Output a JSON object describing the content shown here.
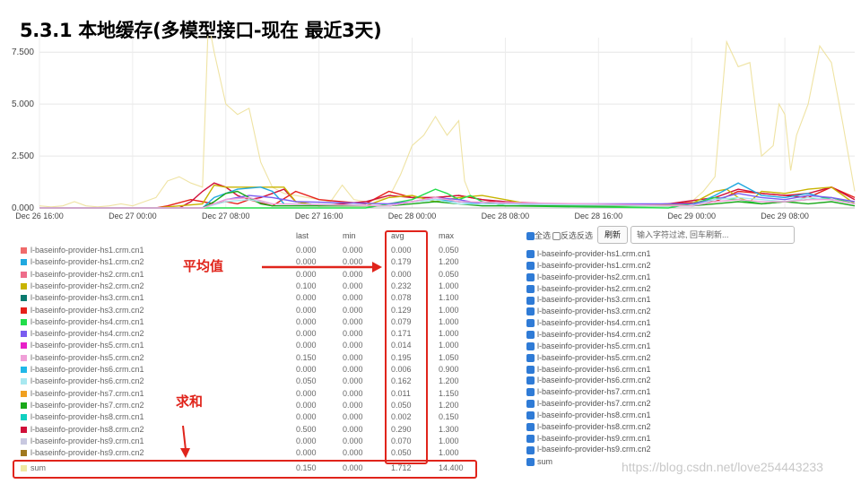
{
  "slide_title": "5.3.1 本地缓存(多模型接口-现在 最近3天)",
  "annotations": {
    "avg_label": "平均值",
    "sum_label": "求和"
  },
  "table": {
    "headers": {
      "last": "last",
      "min": "min",
      "avg": "avg",
      "max": "max"
    },
    "rows": [
      {
        "name": "l-baseinfo-provider-hs1.crm.cn1",
        "color": "#f06b6b",
        "last": "0.000",
        "min": "0.000",
        "avg": "0.000",
        "max": "0.050"
      },
      {
        "name": "l-baseinfo-provider-hs1.crm.cn2",
        "color": "#20a9e0",
        "last": "0.000",
        "min": "0.000",
        "avg": "0.179",
        "max": "1.200"
      },
      {
        "name": "l-baseinfo-provider-hs2.crm.cn1",
        "color": "#ee6c8a",
        "last": "0.000",
        "min": "0.000",
        "avg": "0.000",
        "max": "0.050"
      },
      {
        "name": "l-baseinfo-provider-hs2.crm.cn2",
        "color": "#c8b400",
        "last": "0.100",
        "min": "0.000",
        "avg": "0.232",
        "max": "1.000"
      },
      {
        "name": "l-baseinfo-provider-hs3.crm.cn1",
        "color": "#0a7a6e",
        "last": "0.000",
        "min": "0.000",
        "avg": "0.078",
        "max": "1.100"
      },
      {
        "name": "l-baseinfo-provider-hs3.crm.cn2",
        "color": "#e6201a",
        "last": "0.000",
        "min": "0.000",
        "avg": "0.129",
        "max": "1.000"
      },
      {
        "name": "l-baseinfo-provider-hs4.crm.cn1",
        "color": "#22dd4a",
        "last": "0.000",
        "min": "0.000",
        "avg": "0.079",
        "max": "1.000"
      },
      {
        "name": "l-baseinfo-provider-hs4.crm.cn2",
        "color": "#7a5cf0",
        "last": "0.000",
        "min": "0.000",
        "avg": "0.171",
        "max": "1.000"
      },
      {
        "name": "l-baseinfo-provider-hs5.crm.cn1",
        "color": "#e820c8",
        "last": "0.000",
        "min": "0.000",
        "avg": "0.014",
        "max": "1.000"
      },
      {
        "name": "l-baseinfo-provider-hs5.crm.cn2",
        "color": "#f0a0d8",
        "last": "0.150",
        "min": "0.000",
        "avg": "0.195",
        "max": "1.050"
      },
      {
        "name": "l-baseinfo-provider-hs6.crm.cn1",
        "color": "#20b8e8",
        "last": "0.000",
        "min": "0.000",
        "avg": "0.006",
        "max": "0.900"
      },
      {
        "name": "l-baseinfo-provider-hs6.crm.cn2",
        "color": "#a8e8f0",
        "last": "0.050",
        "min": "0.000",
        "avg": "0.162",
        "max": "1.200"
      },
      {
        "name": "l-baseinfo-provider-hs7.crm.cn1",
        "color": "#f0a020",
        "last": "0.000",
        "min": "0.000",
        "avg": "0.011",
        "max": "1.150"
      },
      {
        "name": "l-baseinfo-provider-hs7.crm.cn2",
        "color": "#1aa81a",
        "last": "0.000",
        "min": "0.000",
        "avg": "0.050",
        "max": "1.200"
      },
      {
        "name": "l-baseinfo-provider-hs8.crm.cn1",
        "color": "#10d0c0",
        "last": "0.000",
        "min": "0.000",
        "avg": "0.002",
        "max": "0.150"
      },
      {
        "name": "l-baseinfo-provider-hs8.crm.cn2",
        "color": "#d0103a",
        "last": "0.500",
        "min": "0.000",
        "avg": "0.290",
        "max": "1.300"
      },
      {
        "name": "l-baseinfo-provider-hs9.crm.cn1",
        "color": "#c8c8e0",
        "last": "0.000",
        "min": "0.000",
        "avg": "0.070",
        "max": "1.000"
      },
      {
        "name": "l-baseinfo-provider-hs9.crm.cn2",
        "color": "#a0781e",
        "last": "0.000",
        "min": "0.000",
        "avg": "0.050",
        "max": "1.000"
      },
      {
        "name": "sum",
        "color": "#f0e8a0",
        "last": "0.150",
        "min": "0.000",
        "avg": "1.712",
        "max": "14.400"
      }
    ]
  },
  "filter": {
    "select_all": "全选",
    "invert": "反选",
    "invert_suffix": "反选",
    "refresh_label": "刷新",
    "input_placeholder": "输入字符过滤, 回车刷新..."
  },
  "right_list": [
    "l-baseinfo-provider-hs1.crm.cn1",
    "l-baseinfo-provider-hs1.crm.cn2",
    "l-baseinfo-provider-hs2.crm.cn1",
    "l-baseinfo-provider-hs2.crm.cn2",
    "l-baseinfo-provider-hs3.crm.cn1",
    "l-baseinfo-provider-hs3.crm.cn2",
    "l-baseinfo-provider-hs4.crm.cn1",
    "l-baseinfo-provider-hs4.crm.cn2",
    "l-baseinfo-provider-hs5.crm.cn1",
    "l-baseinfo-provider-hs5.crm.cn2",
    "l-baseinfo-provider-hs6.crm.cn1",
    "l-baseinfo-provider-hs6.crm.cn2",
    "l-baseinfo-provider-hs7.crm.cn1",
    "l-baseinfo-provider-hs7.crm.cn2",
    "l-baseinfo-provider-hs8.crm.cn1",
    "l-baseinfo-provider-hs8.crm.cn2",
    "l-baseinfo-provider-hs9.crm.cn1",
    "l-baseinfo-provider-hs9.crm.cn2",
    "sum"
  ],
  "watermark": "https://blog.csdn.net/love254443233",
  "chart_data": {
    "type": "line",
    "ylim": [
      0,
      8.2
    ],
    "y_ticks": [
      "0.000",
      "2.500",
      "5.000",
      "7.500"
    ],
    "y_tick_values": [
      0,
      2.5,
      5,
      7.5
    ],
    "x_ticks": [
      "Dec 26 16:00",
      "Dec 27 00:00",
      "Dec 27 08:00",
      "Dec 27 16:00",
      "Dec 28 00:00",
      "Dec 28 08:00",
      "Dec 28 16:00",
      "Dec 29 00:00",
      "Dec 29 08:00"
    ],
    "x_tick_hours": [
      16,
      24,
      32,
      40,
      48,
      56,
      64,
      72,
      80
    ],
    "xlim_hours": [
      16,
      86
    ],
    "series": [
      {
        "name": "sum",
        "color": "#efe3a3",
        "x": [
          16,
          17,
          18,
          19,
          20,
          21,
          22,
          23,
          24,
          25,
          26,
          27,
          28,
          29,
          30,
          30.5,
          31,
          32,
          33,
          34,
          35,
          36,
          37,
          38,
          39,
          40,
          41,
          42,
          43,
          44,
          45,
          46,
          47,
          48,
          49,
          50,
          51,
          52,
          52.5,
          53,
          54,
          55,
          56,
          57,
          58,
          59,
          60,
          61,
          62,
          63,
          64,
          65,
          66,
          67,
          68,
          69,
          70,
          71,
          72,
          73,
          74,
          75,
          76,
          77,
          78,
          79,
          79.5,
          80,
          80.5,
          81,
          82,
          83,
          84,
          85,
          86
        ],
        "y": [
          0.1,
          0.05,
          0.1,
          0.3,
          0.1,
          0.05,
          0.1,
          0.2,
          0.1,
          0.3,
          0.5,
          1.3,
          1.5,
          1.2,
          1.0,
          9.0,
          7.5,
          5.0,
          4.5,
          4.8,
          2.2,
          1.0,
          0.7,
          0.6,
          0.5,
          0.4,
          0.3,
          1.1,
          0.4,
          0.3,
          0.4,
          0.5,
          1.6,
          3.0,
          3.5,
          4.4,
          3.5,
          4.2,
          1.3,
          0.6,
          0.3,
          0.2,
          0.1,
          0.1,
          0.2,
          0.1,
          0.1,
          0.2,
          0.1,
          0.1,
          0.1,
          0.1,
          0.1,
          0.2,
          0.1,
          0.2,
          0.1,
          0.2,
          0.3,
          0.8,
          1.5,
          8.0,
          6.8,
          7.0,
          2.5,
          3.0,
          5.0,
          4.5,
          1.8,
          3.5,
          5.0,
          7.8,
          7.0,
          4.0,
          0.8
        ]
      },
      {
        "name": "l-baseinfo-provider-hs3.crm.cn2",
        "color": "#e6201a",
        "x": [
          16,
          26,
          27,
          29,
          30,
          31,
          32,
          33,
          34,
          36,
          38,
          40,
          44,
          46,
          48,
          50,
          52,
          54,
          56,
          62,
          66,
          70,
          74,
          76,
          78,
          80,
          82,
          84,
          86
        ],
        "y": [
          0,
          0,
          0.1,
          0.4,
          0.3,
          0.2,
          0.3,
          0.2,
          0.4,
          0.1,
          0.8,
          0.4,
          0.2,
          0.8,
          0.5,
          0.5,
          0.6,
          0.4,
          0.2,
          0.1,
          0.1,
          0.2,
          0.3,
          0.8,
          0.7,
          0.6,
          0.5,
          1.0,
          0.5
        ]
      },
      {
        "name": "l-baseinfo-provider-hs8.crm.cn2",
        "color": "#d0103a",
        "x": [
          16,
          28,
          29,
          30,
          31,
          32,
          33,
          34,
          35,
          36,
          37,
          38,
          40,
          42,
          44,
          46,
          48,
          50,
          52,
          54,
          56,
          64,
          70,
          74,
          76,
          78,
          80,
          82,
          84,
          85,
          86
        ],
        "y": [
          0,
          0,
          0.3,
          0.8,
          1.2,
          1.0,
          0.6,
          0.4,
          0.5,
          0.7,
          0.9,
          0.3,
          0.1,
          0.2,
          0.3,
          0.6,
          0.5,
          0.5,
          0.6,
          0.4,
          0.3,
          0.1,
          0.2,
          0.5,
          0.9,
          0.7,
          0.6,
          0.7,
          1.0,
          0.7,
          0.4
        ]
      },
      {
        "name": "l-baseinfo-provider-hs2.crm.cn2",
        "color": "#c8b400",
        "x": [
          16,
          26,
          28,
          30,
          31,
          32,
          34,
          36,
          37,
          38,
          40,
          44,
          46,
          48,
          50,
          52,
          54,
          58,
          66,
          72,
          74,
          75,
          76,
          77,
          78,
          80,
          82,
          84,
          85,
          86
        ],
        "y": [
          0,
          0,
          0.1,
          0.2,
          1.1,
          1.0,
          1.0,
          1.0,
          1.0,
          0.3,
          0.1,
          0.1,
          0.5,
          0.6,
          0.3,
          0.5,
          0.6,
          0.2,
          0.1,
          0.2,
          0.8,
          0.9,
          0.5,
          0.3,
          0.8,
          0.7,
          0.9,
          1.0,
          0.6,
          0.2
        ]
      },
      {
        "name": "l-baseinfo-provider-hs1.crm.cn2",
        "color": "#20a9e0",
        "x": [
          16,
          30,
          31,
          33,
          35,
          36,
          37,
          46,
          48,
          50,
          52,
          54,
          72,
          74,
          76,
          78,
          80,
          82,
          84,
          86
        ],
        "y": [
          0,
          0,
          0.5,
          0.9,
          1.0,
          0.8,
          0.2,
          0.1,
          0.3,
          0.4,
          0.3,
          0.2,
          0.1,
          0.6,
          1.2,
          0.6,
          0.5,
          0.7,
          0.4,
          0.2
        ]
      },
      {
        "name": "l-baseinfo-provider-hs4.crm.cn1",
        "color": "#22dd4a",
        "x": [
          16,
          44,
          46,
          48,
          50,
          51,
          52,
          53,
          54,
          56,
          70,
          72,
          74,
          76,
          78,
          80,
          82,
          84,
          86
        ],
        "y": [
          0,
          0,
          0.2,
          0.4,
          0.9,
          0.7,
          0.4,
          0.6,
          0.3,
          0.1,
          0,
          0.2,
          0.5,
          0.4,
          0.2,
          0.3,
          0.4,
          0.5,
          0.2
        ]
      },
      {
        "name": "l-baseinfo-provider-hs4.crm.cn2",
        "color": "#7a5cf0",
        "x": [
          16,
          30,
          32,
          34,
          36,
          38,
          46,
          48,
          50,
          52,
          54,
          72,
          74,
          76,
          78,
          80,
          82,
          84,
          86
        ],
        "y": [
          0,
          0,
          0.4,
          0.6,
          0.5,
          0.3,
          0.2,
          0.3,
          0.5,
          0.4,
          0.2,
          0.2,
          0.4,
          0.7,
          0.5,
          0.4,
          0.6,
          0.5,
          0.3
        ]
      },
      {
        "name": "l-baseinfo-provider-hs7.crm.cn2",
        "color": "#1aa81a",
        "x": [
          16,
          30,
          31,
          32,
          33,
          34,
          35,
          36,
          46,
          48,
          50,
          52,
          54,
          72,
          74,
          76,
          78,
          80,
          82,
          84,
          86
        ],
        "y": [
          0,
          0,
          0.3,
          0.7,
          0.8,
          0.5,
          0.2,
          0.1,
          0.1,
          0.2,
          0.3,
          0.2,
          0.1,
          0.1,
          0.2,
          0.3,
          0.2,
          0.3,
          0.2,
          0.3,
          0.1
        ]
      },
      {
        "name": "l-baseinfo-provider-hs6.crm.cn2",
        "color": "#a8e8f0",
        "x": [
          16,
          30,
          32,
          34,
          36,
          46,
          48,
          50,
          52,
          72,
          74,
          76,
          78,
          80,
          82,
          84,
          86
        ],
        "y": [
          0,
          0,
          0.3,
          0.4,
          0.2,
          0.1,
          0.3,
          0.4,
          0.2,
          0.1,
          0.4,
          0.5,
          0.4,
          0.3,
          0.5,
          0.4,
          0.2
        ]
      },
      {
        "name": "l-baseinfo-provider-hs5.crm.cn2",
        "color": "#f0a0d8",
        "x": [
          16,
          30,
          32,
          34,
          36,
          46,
          48,
          50,
          52,
          72,
          74,
          76,
          78,
          80,
          82,
          84,
          86
        ],
        "y": [
          0,
          0,
          0.4,
          0.5,
          0.2,
          0.1,
          0.3,
          0.5,
          0.3,
          0.1,
          0.3,
          0.4,
          0.3,
          0.3,
          0.4,
          0.4,
          0.2
        ]
      }
    ]
  }
}
